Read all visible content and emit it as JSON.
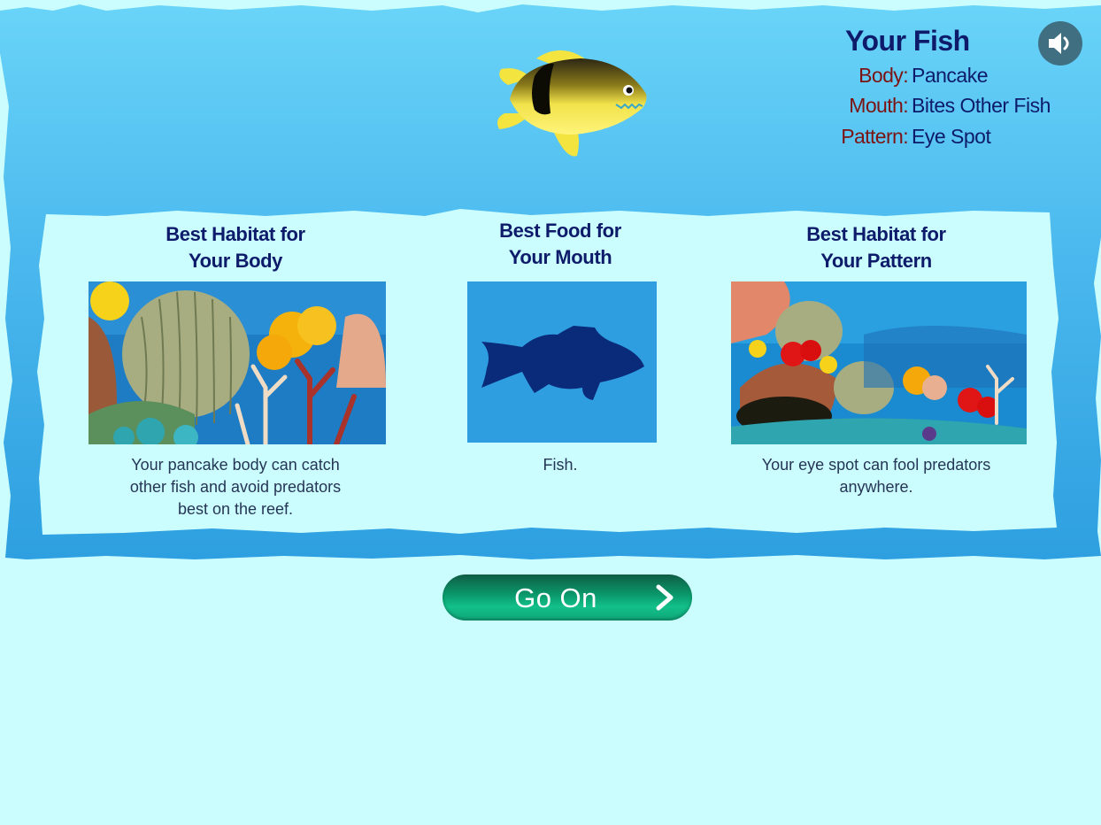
{
  "fish_info": {
    "title": "Your Fish",
    "traits": [
      {
        "label": "Body:",
        "value": "Pancake"
      },
      {
        "label": "Mouth:",
        "value": "Bites Other Fish"
      },
      {
        "label": "Pattern:",
        "value": "Eye Spot"
      }
    ]
  },
  "cards": [
    {
      "heading": [
        "Best Habitat for",
        "Your Body"
      ],
      "image": "coral-reef-habitat",
      "text": [
        "Your pancake body can catch",
        "other fish and avoid predators",
        "best on the reef."
      ]
    },
    {
      "heading": [
        "Best Food for",
        "Your Mouth"
      ],
      "image": "fish-silhouette",
      "text": [
        "Fish."
      ]
    },
    {
      "heading": [
        "Best Habitat for",
        "Your Pattern"
      ],
      "image": "coral-reef-habitat",
      "text": [
        "Your eye spot can fool predators",
        "anywhere."
      ]
    }
  ],
  "go_on_button": {
    "label": "Go On",
    "icon": "chevron-right-icon"
  },
  "sound_button": {
    "icon": "speaker-icon"
  },
  "colors": {
    "water": "#5cc8f2",
    "panel": "#cbfdfe",
    "heading": "#0d1b6a",
    "trait_label": "#7b1313",
    "button": "#0a9a6c"
  }
}
